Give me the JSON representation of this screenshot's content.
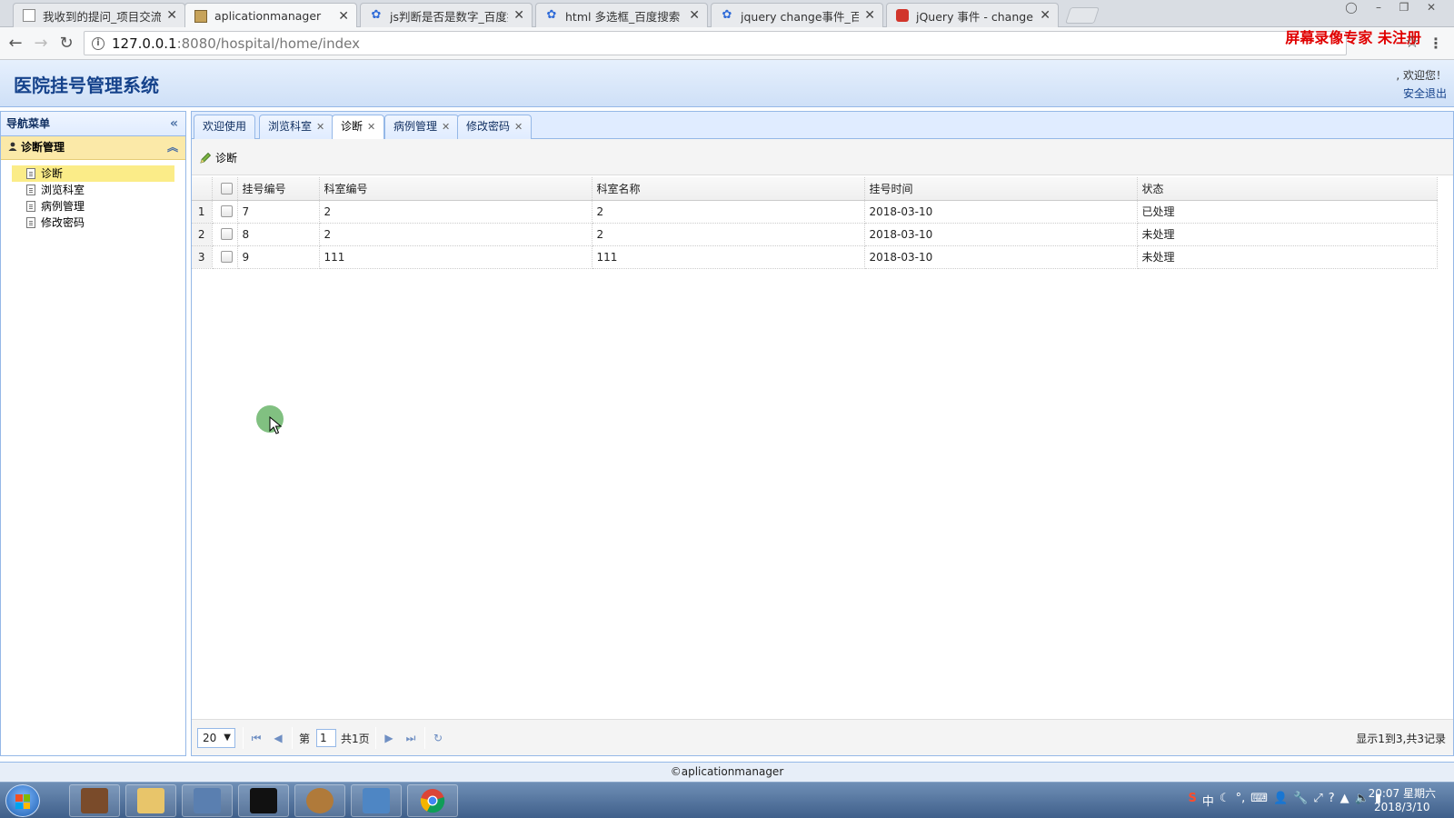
{
  "browser": {
    "tabs": [
      {
        "title": "我收到的提问_项目交流",
        "icon": "doc-icon"
      },
      {
        "title": "aplicationmanager",
        "icon": "image-icon"
      },
      {
        "title": "js判断是否是数字_百度搜",
        "icon": "paw-icon"
      },
      {
        "title": "html 多选框_百度搜索",
        "icon": "paw-icon"
      },
      {
        "title": "jquery change事件_百度",
        "icon": "paw-icon"
      },
      {
        "title": "jQuery 事件 - change()",
        "icon": "red-logo-icon"
      }
    ],
    "url_host": "127.0.0.1",
    "url_path": ":8080/hospital/home/index",
    "watermark": "屏幕录像专家  未注册"
  },
  "app": {
    "title": "医院挂号管理系统",
    "welcome": ", 欢迎您！",
    "logout": "安全退出"
  },
  "nav": {
    "title": "导航菜单",
    "group": "诊断管理",
    "items": [
      "诊断",
      "浏览科室",
      "病例管理",
      "修改密码"
    ],
    "selected": "诊断"
  },
  "tabs": [
    {
      "label": "欢迎使用",
      "closable": false
    },
    {
      "label": "浏览科室",
      "closable": true
    },
    {
      "label": "诊断",
      "closable": true
    },
    {
      "label": "病例管理",
      "closable": true
    },
    {
      "label": "修改密码",
      "closable": true
    }
  ],
  "active_tab": "诊断",
  "toolbar": {
    "diagnose_label": "诊断"
  },
  "grid": {
    "columns": [
      "挂号编号",
      "科室编号",
      "科室名称",
      "挂号时间",
      "状态"
    ],
    "rows": [
      {
        "num": "1",
        "cells": [
          "7",
          "2",
          "2",
          "2018-03-10",
          "已处理"
        ]
      },
      {
        "num": "2",
        "cells": [
          "8",
          "2",
          "2",
          "2018-03-10",
          "未处理"
        ]
      },
      {
        "num": "3",
        "cells": [
          "9",
          "111",
          "111",
          "2018-03-10",
          "未处理"
        ]
      }
    ]
  },
  "pager": {
    "page_size": "20",
    "page_prefix": "第",
    "page_value": "1",
    "page_total": "共1页",
    "info": "显示1到3,共3记录"
  },
  "footer": "©aplicationmanager",
  "taskbar": {
    "clock_time": "20:07 星期六",
    "clock_date": "2018/3/10"
  }
}
